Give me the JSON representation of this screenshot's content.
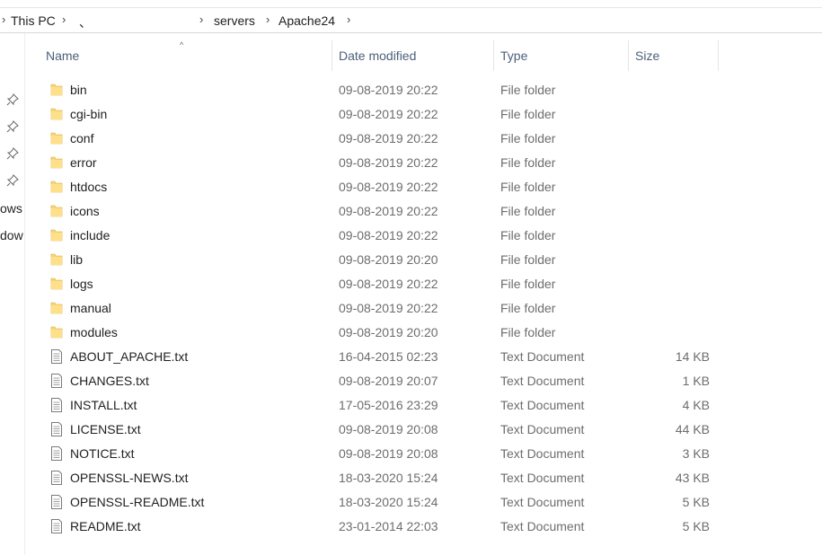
{
  "breadcrumb": {
    "items": [
      "This PC",
      "、",
      "servers",
      "Apache24"
    ]
  },
  "sidebar": {
    "labels": [
      "ows",
      "dow"
    ]
  },
  "columns": {
    "name": "Name",
    "date": "Date modified",
    "type": "Type",
    "size": "Size"
  },
  "files": [
    {
      "name": "bin",
      "date": "09-08-2019 20:22",
      "type": "File folder",
      "size": "",
      "icon": "folder-icon"
    },
    {
      "name": "cgi-bin",
      "date": "09-08-2019 20:22",
      "type": "File folder",
      "size": "",
      "icon": "folder-icon"
    },
    {
      "name": "conf",
      "date": "09-08-2019 20:22",
      "type": "File folder",
      "size": "",
      "icon": "folder-icon"
    },
    {
      "name": "error",
      "date": "09-08-2019 20:22",
      "type": "File folder",
      "size": "",
      "icon": "folder-icon"
    },
    {
      "name": "htdocs",
      "date": "09-08-2019 20:22",
      "type": "File folder",
      "size": "",
      "icon": "folder-icon"
    },
    {
      "name": "icons",
      "date": "09-08-2019 20:22",
      "type": "File folder",
      "size": "",
      "icon": "folder-icon"
    },
    {
      "name": "include",
      "date": "09-08-2019 20:22",
      "type": "File folder",
      "size": "",
      "icon": "folder-icon"
    },
    {
      "name": "lib",
      "date": "09-08-2019 20:20",
      "type": "File folder",
      "size": "",
      "icon": "folder-icon"
    },
    {
      "name": "logs",
      "date": "09-08-2019 20:22",
      "type": "File folder",
      "size": "",
      "icon": "folder-icon"
    },
    {
      "name": "manual",
      "date": "09-08-2019 20:22",
      "type": "File folder",
      "size": "",
      "icon": "folder-icon"
    },
    {
      "name": "modules",
      "date": "09-08-2019 20:20",
      "type": "File folder",
      "size": "",
      "icon": "folder-icon"
    },
    {
      "name": "ABOUT_APACHE.txt",
      "date": "16-04-2015 02:23",
      "type": "Text Document",
      "size": "14 KB",
      "icon": "text-document-icon"
    },
    {
      "name": "CHANGES.txt",
      "date": "09-08-2019 20:07",
      "type": "Text Document",
      "size": "1 KB",
      "icon": "text-document-icon"
    },
    {
      "name": "INSTALL.txt",
      "date": "17-05-2016 23:29",
      "type": "Text Document",
      "size": "4 KB",
      "icon": "text-document-icon"
    },
    {
      "name": "LICENSE.txt",
      "date": "09-08-2019 20:08",
      "type": "Text Document",
      "size": "44 KB",
      "icon": "text-document-icon"
    },
    {
      "name": "NOTICE.txt",
      "date": "09-08-2019 20:08",
      "type": "Text Document",
      "size": "3 KB",
      "icon": "text-document-icon"
    },
    {
      "name": "OPENSSL-NEWS.txt",
      "date": "18-03-2020 15:24",
      "type": "Text Document",
      "size": "43 KB",
      "icon": "text-document-icon"
    },
    {
      "name": "OPENSSL-README.txt",
      "date": "18-03-2020 15:24",
      "type": "Text Document",
      "size": "5 KB",
      "icon": "text-document-icon"
    },
    {
      "name": "README.txt",
      "date": "23-01-2014 22:03",
      "type": "Text Document",
      "size": "5 KB",
      "icon": "text-document-icon"
    }
  ],
  "colors": {
    "folder": "#f8d775",
    "header_text": "#4c607a",
    "secondary_text": "#6d6d6d"
  }
}
